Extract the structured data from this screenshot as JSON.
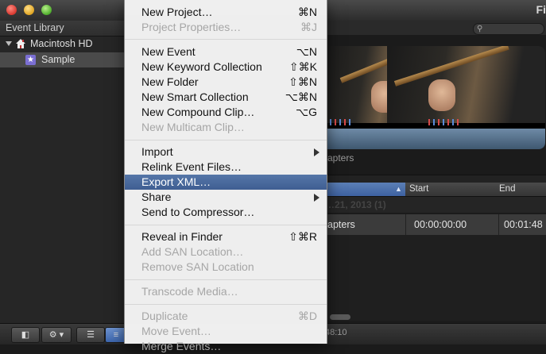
{
  "window": {
    "title": "Fi"
  },
  "sidebar": {
    "header": "Event Library",
    "items": [
      {
        "label": "Macintosh HD",
        "icon": "house-icon"
      },
      {
        "label": "Sample",
        "icon": "star-icon"
      }
    ]
  },
  "viewer": {
    "clip_title": "apters"
  },
  "list": {
    "columns": [
      "",
      "Start",
      "End"
    ],
    "group_label": "…21, 2013 (1)",
    "rows": [
      {
        "name": "apters",
        "start": "00:00:00:00",
        "end": "00:01:48"
      }
    ]
  },
  "bottom": {
    "duration": "48:10"
  },
  "menu": {
    "sections": [
      [
        {
          "label": "New Project…",
          "shortcut": "⌘N",
          "enabled": true
        },
        {
          "label": "Project Properties…",
          "shortcut": "⌘J",
          "enabled": false
        }
      ],
      [
        {
          "label": "New Event",
          "shortcut": "⌥N",
          "enabled": true
        },
        {
          "label": "New Keyword Collection",
          "shortcut": "⇧⌘K",
          "enabled": true
        },
        {
          "label": "New Folder",
          "shortcut": "⇧⌘N",
          "enabled": true
        },
        {
          "label": "New Smart Collection",
          "shortcut": "⌥⌘N",
          "enabled": true
        },
        {
          "label": "New Compound Clip…",
          "shortcut": "⌥G",
          "enabled": true
        },
        {
          "label": "New Multicam Clip…",
          "shortcut": "",
          "enabled": false
        }
      ],
      [
        {
          "label": "Import",
          "shortcut": "",
          "submenu": true,
          "enabled": true
        },
        {
          "label": "Relink Event Files…",
          "shortcut": "",
          "enabled": true
        },
        {
          "label": "Export XML…",
          "shortcut": "",
          "enabled": true,
          "highlighted": true
        },
        {
          "label": "Share",
          "shortcut": "",
          "submenu": true,
          "enabled": true
        },
        {
          "label": "Send to Compressor…",
          "shortcut": "",
          "enabled": true
        }
      ],
      [
        {
          "label": "Reveal in Finder",
          "shortcut": "⇧⌘R",
          "enabled": true
        },
        {
          "label": "Add SAN Location…",
          "shortcut": "",
          "enabled": false
        },
        {
          "label": "Remove SAN Location",
          "shortcut": "",
          "enabled": false
        }
      ],
      [
        {
          "label": "Transcode Media…",
          "shortcut": "",
          "enabled": false
        }
      ],
      [
        {
          "label": "Duplicate",
          "shortcut": "⌘D",
          "enabled": false
        },
        {
          "label": "Move Event…",
          "shortcut": "",
          "enabled": false
        },
        {
          "label": "Merge Events…",
          "shortcut": "",
          "enabled": false
        }
      ]
    ]
  },
  "colors": {
    "menu_highlight": "#4a6aa0",
    "selection": "#4a4a4a",
    "sample_icon": "#7b6fd3"
  }
}
